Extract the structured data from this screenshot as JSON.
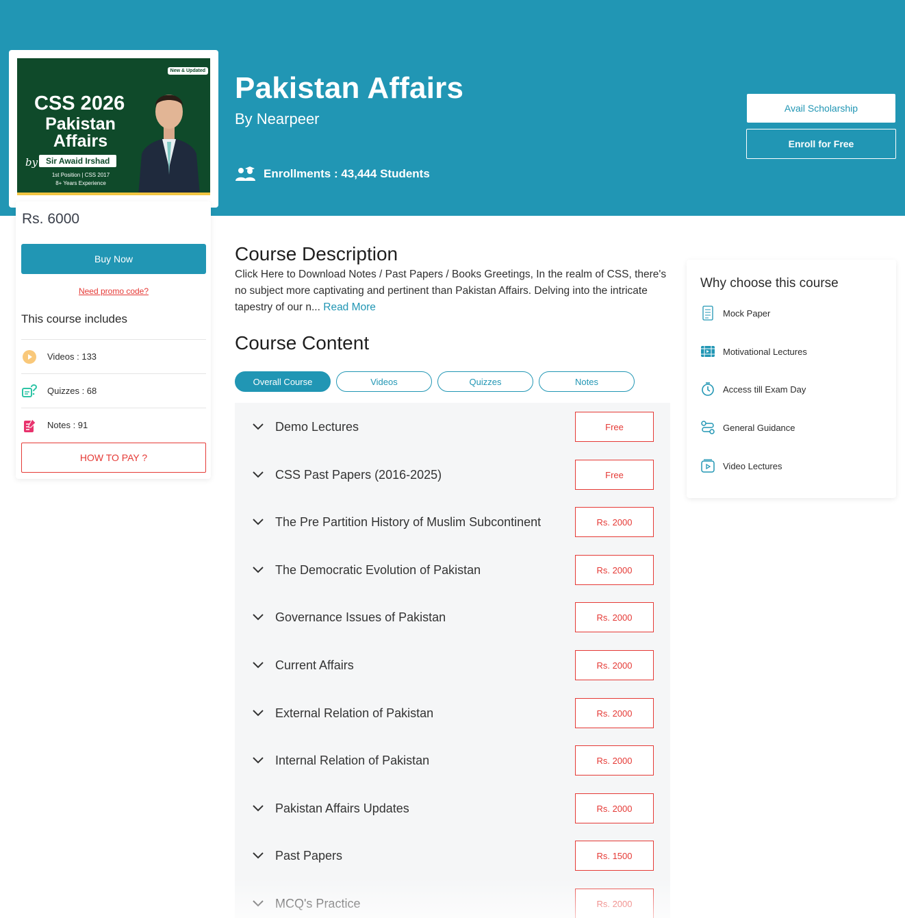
{
  "hero": {
    "title": "Pakistan Affairs",
    "subtitle": "By Nearpeer",
    "enrollments": "Enrollments : 43,444 Students",
    "scholarship_button": "Avail Scholarship",
    "enroll_button": "Enroll for Free",
    "color": "#2196b4"
  },
  "thumbnail": {
    "tag": "New & Updated",
    "line1": "CSS 2026",
    "line2": "Pakistan Affairs",
    "by": "by",
    "instructor": "Sir Awaid Irshad",
    "detail1": "1st Position | CSS 2017",
    "detail2": "8+ Years Experience"
  },
  "sidebar": {
    "price": "Rs. 6000",
    "buy_button": "Buy Now",
    "promo_link": "Need promo code?",
    "includes_title": "This course includes",
    "includes": [
      {
        "icon": "play-icon",
        "label": "Videos : 133"
      },
      {
        "icon": "quiz-icon",
        "label": "Quizzes : 68"
      },
      {
        "icon": "notes-icon",
        "label": "Notes : 91"
      }
    ],
    "howto_button": "HOW TO PAY ?"
  },
  "main": {
    "description_title": "Course Description",
    "description": "Click Here to Download Notes / Past Papers / Books Greetings, In the realm of CSS, there's no subject more captivating and pertinent than Pakistan Affairs. Delving into the intricate tapestry of our n...",
    "read_more": "Read More",
    "content_title": "Course Content",
    "tabs": [
      "Overall Course",
      "Videos",
      "Quizzes",
      "Notes"
    ],
    "sections": [
      {
        "label": "Demo Lectures",
        "price": "Free"
      },
      {
        "label": "CSS Past Papers (2016-2025)",
        "price": "Free"
      },
      {
        "label": "The Pre Partition History of Muslim Subcontinent",
        "price": "Rs. 2000"
      },
      {
        "label": "The Democratic Evolution of Pakistan",
        "price": "Rs. 2000"
      },
      {
        "label": "Governance Issues of Pakistan",
        "price": "Rs. 2000"
      },
      {
        "label": "Current Affairs",
        "price": "Rs. 2000"
      },
      {
        "label": "External Relation of Pakistan",
        "price": "Rs. 2000"
      },
      {
        "label": "Internal Relation of Pakistan",
        "price": "Rs. 2000"
      },
      {
        "label": "Pakistan Affairs Updates",
        "price": "Rs. 2000"
      },
      {
        "label": "Past Papers",
        "price": "Rs. 1500"
      },
      {
        "label": "MCQ's Practice",
        "price": "Rs. 2000"
      }
    ]
  },
  "why": {
    "title": "Why choose this course",
    "items": [
      {
        "icon": "document-icon",
        "label": "Mock Paper"
      },
      {
        "icon": "film-icon",
        "label": "Motivational Lectures"
      },
      {
        "icon": "timer-icon",
        "label": "Access till Exam Day"
      },
      {
        "icon": "route-icon",
        "label": "General Guidance"
      },
      {
        "icon": "video-icon",
        "label": "Video Lectures"
      }
    ]
  }
}
